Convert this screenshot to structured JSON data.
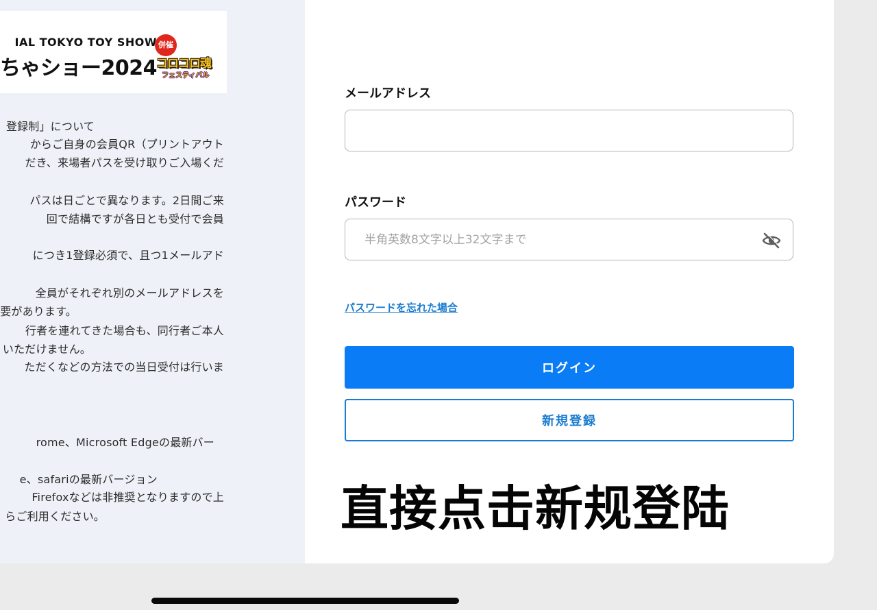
{
  "banner": {
    "line1": "IAL TOKYO TOY SHOW",
    "line2": "ちゃショー2024",
    "badge": "併催",
    "logo_text": "コロコロ魂",
    "logo_sub": "フェスティバル"
  },
  "notice": {
    "lines": [
      "登録制」について",
      "からご自身の会員QR（プリントアウト",
      "だき、来場者パスを受け取りご入場くだ",
      "パスは日ごとで異なります。2日間ご来",
      "回で結構ですが各日とも受付で会員",
      "につき1登録必須で、且つ1メールアド",
      "全員がそれぞれ別のメールアドレスを",
      "要があります。",
      "行者を連れてきた場合も、同行者ご本人",
      "いただけません。",
      "ただくなどの方法での当日受付は行いま",
      "rome、Microsoft Edgeの最新バー",
      "e、safariの最新バージョン",
      "Firefoxなどは非推奨となりますので上",
      "らご利用ください。"
    ]
  },
  "form": {
    "email_label": "メールアドレス",
    "email_value": "",
    "password_label": "パスワード",
    "password_placeholder": "半角英数8文字以上32文字まで",
    "forgot_link": "パスワードを忘れた場合",
    "login_button": "ログイン",
    "register_button": "新規登録"
  },
  "overlay": {
    "caption": "直接点击新规登陆"
  },
  "colors": {
    "primary": "#0a7cf5",
    "link": "#1a7cd0",
    "left_panel_bg": "#eef1f7",
    "page_bg": "#ebebeb"
  },
  "icons": {
    "password_toggle": "eye-slash-icon"
  }
}
